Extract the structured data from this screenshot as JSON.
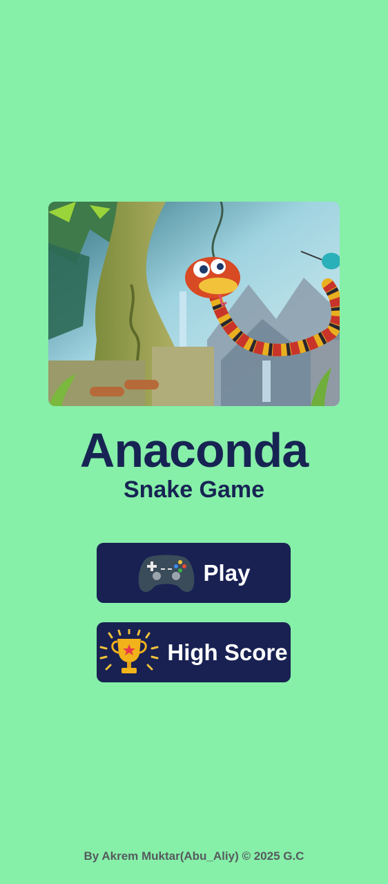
{
  "hero": {
    "image_name": "jungle-snake-illustration"
  },
  "app": {
    "title": "Anaconda",
    "subtitle": "Snake Game"
  },
  "buttons": {
    "play_label": "Play",
    "play_icon": "gamepad-icon",
    "highscore_label": "High Score",
    "highscore_icon": "trophy-icon"
  },
  "footer": {
    "credit": "By Akrem Muktar(Abu_Aliy) © 2025 G.C"
  },
  "colors": {
    "background": "#86EFA8",
    "accent": "#182152",
    "title": "#172453",
    "footer_text": "#555a5e"
  }
}
